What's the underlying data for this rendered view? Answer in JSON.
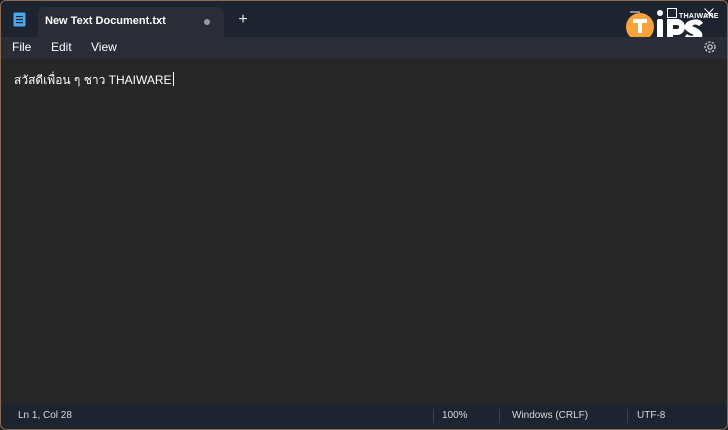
{
  "window": {
    "tab_title": "New Text Document.txt",
    "new_tab_label": "+",
    "modified": true
  },
  "watermark": {
    "brand": "THAIWARE"
  },
  "menu": {
    "items": [
      "File",
      "Edit",
      "View"
    ]
  },
  "editor": {
    "content": "สวัสดีเพื่อน ๆ ชาว THAIWARE"
  },
  "status": {
    "position": "Ln 1, Col 28",
    "zoom": "100%",
    "line_ending": "Windows (CRLF)",
    "encoding": "UTF-8"
  },
  "colors": {
    "titlebar_bg": "#1e2330",
    "menubar_bg": "#2a2d35",
    "editor_bg": "#272727",
    "text": "#ffffff",
    "accent_icon": "#4da6e8",
    "logo_orange": "#f7a23b"
  }
}
